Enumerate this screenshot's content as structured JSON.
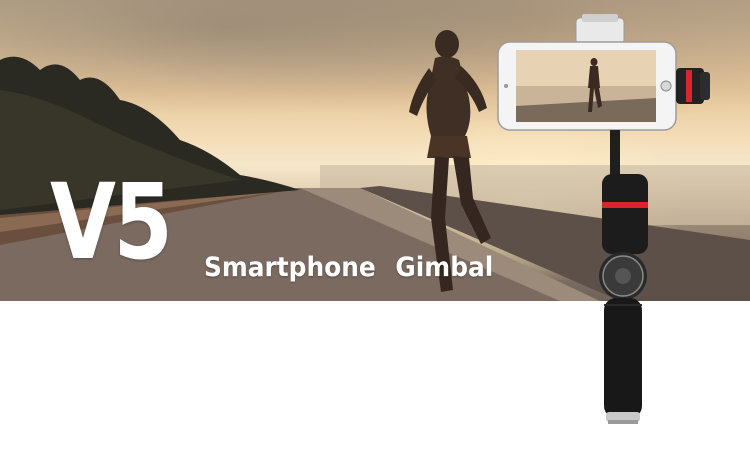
{
  "product": {
    "model": "V5",
    "subtitle": "Smartphone  Gimbal"
  },
  "colors": {
    "sky_top": "#b9a58a",
    "sunset_glow": "#f6e7cc",
    "title_text": "#ffffff",
    "gimbal_body": "#1c1c1c",
    "accent_ring": "#d8262b",
    "page_background": "#ffffff"
  },
  "icons": [
    "gimbal-photo",
    "runner-silhouette",
    "smartphone",
    "joystick-control"
  ]
}
